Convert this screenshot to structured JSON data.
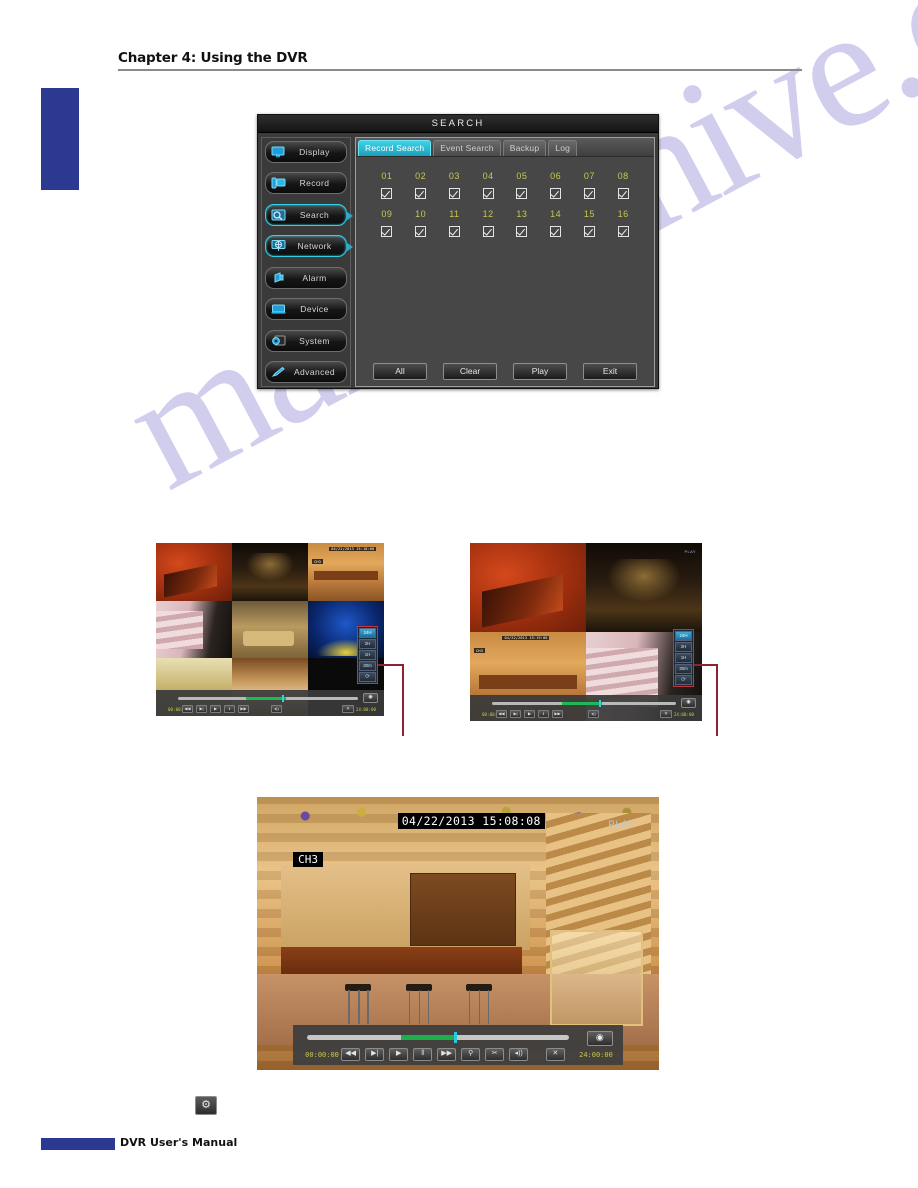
{
  "page": {
    "chapter_title": "Chapter 4: Using the DVR",
    "footer_text": "DVR User's Manual",
    "watermark": "manualshive.com"
  },
  "dvr_dialog": {
    "title": "SEARCH",
    "sidebar": [
      {
        "label": "Display",
        "icon": "monitor-icon",
        "selected": false
      },
      {
        "label": "Record",
        "icon": "record-icon",
        "selected": false
      },
      {
        "label": "Search",
        "icon": "magnifier-icon",
        "selected": true
      },
      {
        "label": "Network",
        "icon": "globe-icon",
        "selected": false
      },
      {
        "label": "Alarm",
        "icon": "alarm-icon",
        "selected": false
      },
      {
        "label": "Device",
        "icon": "device-icon",
        "selected": false
      },
      {
        "label": "System",
        "icon": "gear-icon",
        "selected": false
      },
      {
        "label": "Advanced",
        "icon": "pencil-icon",
        "selected": false
      }
    ],
    "tabs": [
      {
        "label": "Record Search",
        "active": true
      },
      {
        "label": "Event Search",
        "active": false
      },
      {
        "label": "Backup",
        "active": false
      },
      {
        "label": "Log",
        "active": false
      }
    ],
    "channels": [
      {
        "label": "01",
        "checked": true
      },
      {
        "label": "02",
        "checked": true
      },
      {
        "label": "03",
        "checked": true
      },
      {
        "label": "04",
        "checked": true
      },
      {
        "label": "05",
        "checked": true
      },
      {
        "label": "06",
        "checked": true
      },
      {
        "label": "07",
        "checked": true
      },
      {
        "label": "08",
        "checked": true
      },
      {
        "label": "09",
        "checked": true
      },
      {
        "label": "10",
        "checked": true
      },
      {
        "label": "11",
        "checked": true
      },
      {
        "label": "12",
        "checked": true
      },
      {
        "label": "13",
        "checked": true
      },
      {
        "label": "14",
        "checked": true
      },
      {
        "label": "15",
        "checked": true
      },
      {
        "label": "16",
        "checked": true
      }
    ],
    "actions": [
      {
        "label": "All"
      },
      {
        "label": "Clear"
      },
      {
        "label": "Play"
      },
      {
        "label": "Exit"
      }
    ],
    "colors": {
      "accent_tab": "#3fd3e8",
      "channel_label": "#c8c84a",
      "panel_bg": "#474747"
    }
  },
  "multiview_left": {
    "layout": "3x3",
    "scale_menu": [
      {
        "label": "24H",
        "selected": true
      },
      {
        "label": "2H",
        "selected": false
      },
      {
        "label": "1H",
        "selected": false
      },
      {
        "label": "30m",
        "selected": false
      },
      {
        "label": "⟳",
        "selected": false
      }
    ],
    "playbar": {
      "time_start": "00:00:00",
      "time_end": "24:00:00"
    },
    "osd": {
      "timestamp": "04/22/2013 15:18:00",
      "channel": "CH3"
    }
  },
  "multiview_right": {
    "layout": "2x2",
    "scale_menu": [
      {
        "label": "24H",
        "selected": true
      },
      {
        "label": "2H",
        "selected": false
      },
      {
        "label": "1H",
        "selected": false
      },
      {
        "label": "30m",
        "selected": false
      },
      {
        "label": "⟳",
        "selected": false
      }
    ],
    "playbar": {
      "time_start": "00:00:00",
      "time_end": "24:00:00"
    },
    "osd": {
      "timestamp": "04/22/2013 15:19:00",
      "channel": "CH3",
      "status": "PLAY"
    }
  },
  "playback": {
    "timestamp": "04/22/2013 15:08:08",
    "status": "PLAY",
    "channel": "CH3",
    "playbar": {
      "time_start": "00:00:00",
      "time_end": "24:00:00",
      "buttons": [
        {
          "label": "◀◀",
          "name": "rewind-button"
        },
        {
          "label": "▶|",
          "name": "next-frame-button"
        },
        {
          "label": "▶",
          "name": "play-button"
        },
        {
          "label": "‖",
          "name": "pause-button"
        },
        {
          "label": "▶▶",
          "name": "fast-forward-button"
        },
        {
          "label": "⚲",
          "name": "zoom-button"
        },
        {
          "label": "✂",
          "name": "cut-button"
        },
        {
          "label": "◂))",
          "name": "volume-button"
        }
      ],
      "close_label": "✕",
      "eye_label": "◉"
    }
  },
  "footer_gear": {
    "icon": "gear-icon",
    "label": "⚙"
  }
}
